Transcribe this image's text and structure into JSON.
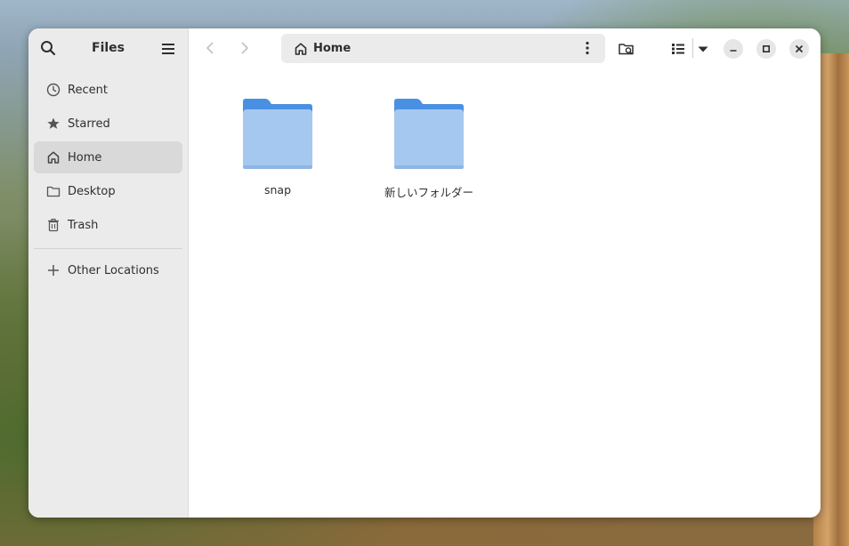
{
  "sidebar": {
    "title": "Files",
    "items": [
      {
        "label": "Recent",
        "icon": "clock-icon"
      },
      {
        "label": "Starred",
        "icon": "star-icon"
      },
      {
        "label": "Home",
        "icon": "home-icon",
        "active": true
      },
      {
        "label": "Desktop",
        "icon": "folder-icon"
      },
      {
        "label": "Trash",
        "icon": "trash-icon"
      }
    ],
    "other_locations": "Other Locations"
  },
  "pathbar": {
    "label": "Home"
  },
  "files": [
    {
      "name": "snap",
      "type": "folder"
    },
    {
      "name": "新しいフォルダー",
      "type": "folder"
    }
  ],
  "colors": {
    "folder_light": "#a5c8f0",
    "folder_dark": "#4a90e2",
    "sidebar_bg": "#ebebeb",
    "active_bg": "#d9d9d9"
  }
}
